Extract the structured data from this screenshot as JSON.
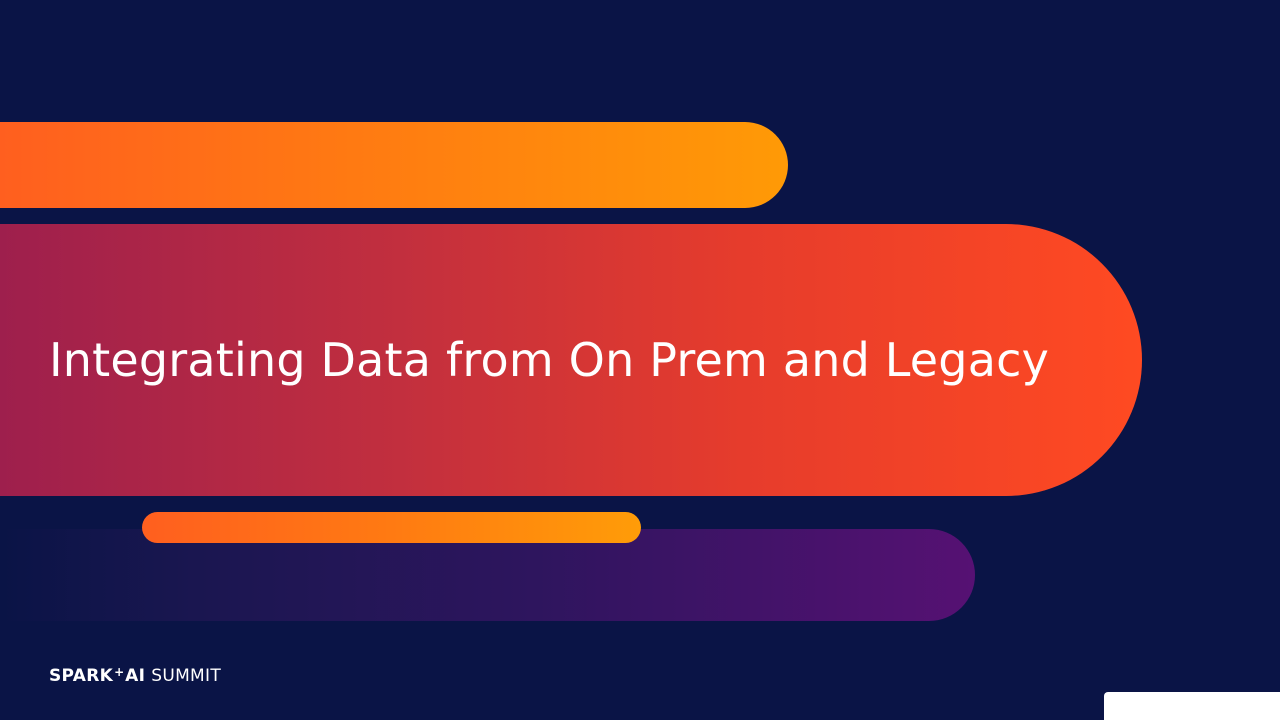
{
  "slide": {
    "title": "Integrating Data from On Prem and Legacy"
  },
  "logo": {
    "word1": "SPARK",
    "plus": "+",
    "word2": "AI",
    "word3": "SUMMIT"
  },
  "colors": {
    "background": "#0a1446",
    "orange": "#ff8a0c",
    "red_orange": "#ff4a22",
    "crimson": "#9e1f4d",
    "purple": "#561173"
  }
}
